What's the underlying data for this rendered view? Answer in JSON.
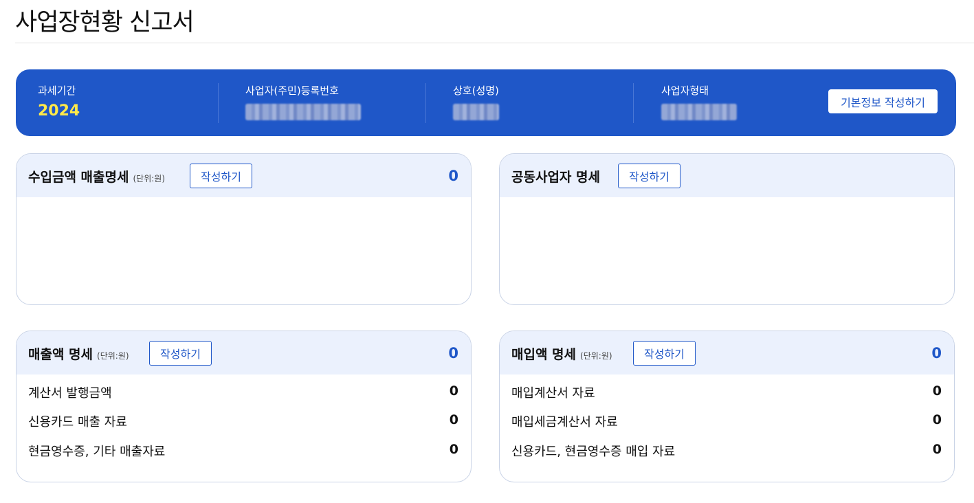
{
  "page": {
    "title": "사업장현황 신고서"
  },
  "info": {
    "tax_period_label": "과세기간",
    "tax_period_value": "2024",
    "registration_label": "사업자(주민)등록번호",
    "company_label": "상호(성명)",
    "business_type_label": "사업자형태",
    "basic_info_button": "기본정보 작성하기"
  },
  "cards": {
    "income": {
      "title": "수입금액 매출명세",
      "unit": "(단위:원)",
      "button": "작성하기",
      "total": "0"
    },
    "partners": {
      "title": "공동사업자 명세",
      "button": "작성하기"
    },
    "sales": {
      "title": "매출액 명세",
      "unit": "(단위:원)",
      "button": "작성하기",
      "total": "0",
      "rows": [
        {
          "label": "계산서 발행금액",
          "value": "0"
        },
        {
          "label": "신용카드 매출 자료",
          "value": "0"
        },
        {
          "label": "현금영수증, 기타 매출자료",
          "value": "0"
        }
      ]
    },
    "purchase": {
      "title": "매입액 명세",
      "unit": "(단위:원)",
      "button": "작성하기",
      "total": "0",
      "rows": [
        {
          "label": "매입계산서 자료",
          "value": "0"
        },
        {
          "label": "매입세금계산서 자료",
          "value": "0"
        },
        {
          "label": "신용카드, 현금영수증 매입 자료",
          "value": "0"
        }
      ]
    }
  },
  "colors": {
    "brand_blue": "#1f57c8",
    "highlight_yellow": "#ffe94a",
    "card_header_bg": "#ebf1fd"
  }
}
